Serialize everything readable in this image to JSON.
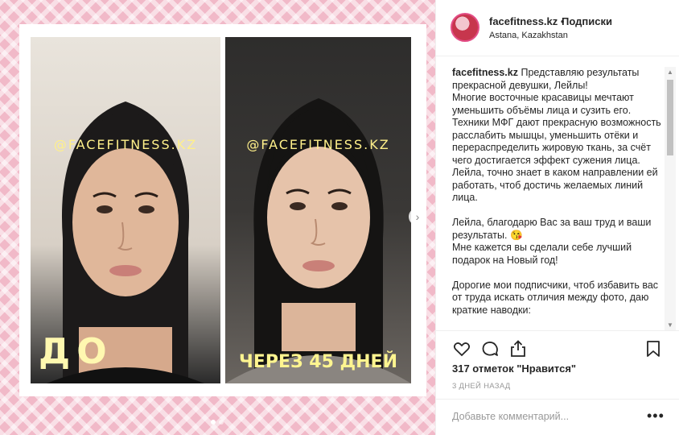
{
  "media": {
    "left_watermark": "@FACEFITNESS.KZ",
    "right_watermark": "@FACEFITNESS.KZ",
    "left_label": "ДО",
    "right_label": "ЧЕРЕЗ 45 ДНЕЙ",
    "next_icon": "chevron-right-icon",
    "carousel_dots": 2,
    "active_dot": 0
  },
  "header": {
    "username": "facefitness.kz",
    "separator": "•",
    "follow_label": "Подписки",
    "location": "Astana, Kazakhstan"
  },
  "caption": {
    "username": "facefitness.kz",
    "text": " Представляю результаты прекрасной девушки, Лейлы!\nМногие восточные красавицы мечтают уменьшить объёмы лица и сузить его.\nТехники МФГ дают прекрасную возможность расслабить мышцы, уменьшить отёки и перераспределить жировую ткань, за счёт чего достигается эффект сужения лица.\nЛейла, точно знает в каком направлении ей работать, чтоб достичь желаемых линий лица.\n\nЛейла, благодарю Вас за ваш труд и ваши результаты. 😘\nМне кажется вы сделали себе лучший подарок на Новый год!\n\nДорогие мои подписчики, чтоб избавить вас от труда искать отличия между фото, даю краткие наводки:"
  },
  "actions": {
    "like_icon": "heart-icon",
    "comment_icon": "comment-icon",
    "share_icon": "share-icon",
    "save_icon": "bookmark-icon"
  },
  "likes_text": "317 отметок \"Нравится\"",
  "time_text": "3 ДНЕЙ НАЗАД",
  "comment": {
    "placeholder": "Добавьте комментарий...",
    "more_label": "•••"
  },
  "colors": {
    "pink_background": "#f1b9c8",
    "text": "#262626",
    "muted": "#999999",
    "avatar_ring": "#e34d86"
  }
}
